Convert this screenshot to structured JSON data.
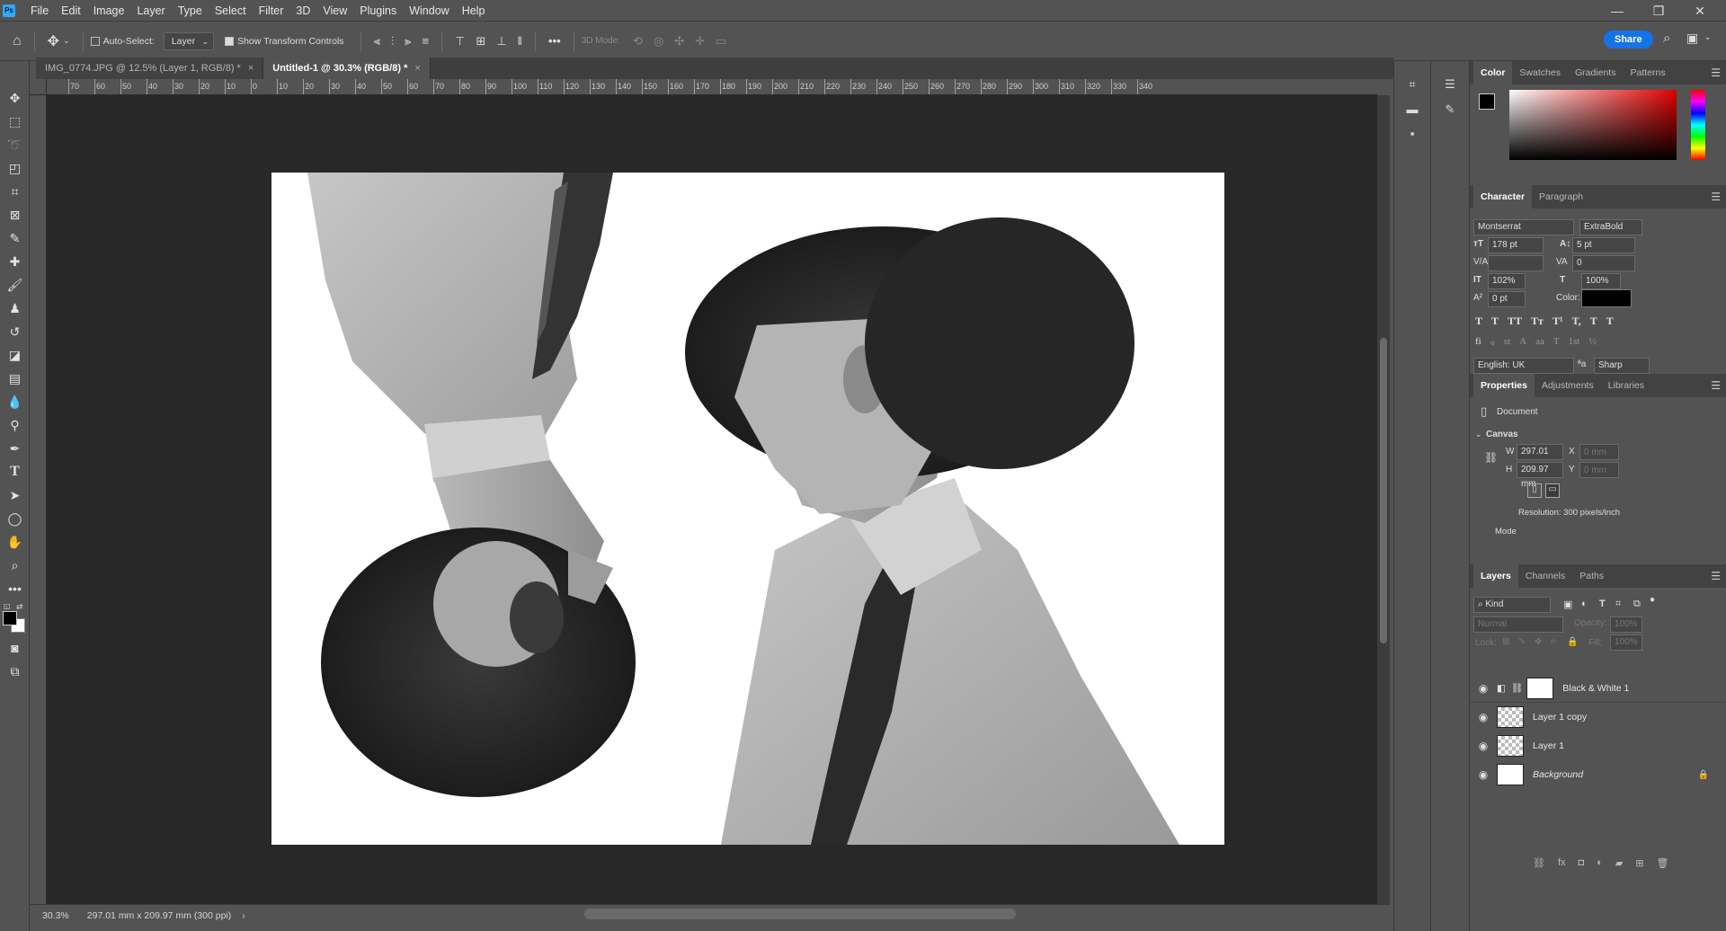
{
  "app": {
    "logo": "Ps"
  },
  "menu": [
    "File",
    "Edit",
    "Image",
    "Layer",
    "Type",
    "Select",
    "Filter",
    "3D",
    "View",
    "Plugins",
    "Window",
    "Help"
  ],
  "window_controls": {
    "minimize": "—",
    "restore": "❐",
    "close": "✕"
  },
  "options_bar": {
    "auto_select_label": "Auto-Select:",
    "layer_select": "Layer",
    "show_transform_label": "Show Transform Controls",
    "mode_3d_label": "3D Mode:",
    "share_label": "Share",
    "more": "•••"
  },
  "tabs": [
    {
      "label": "IMG_0774.JPG @ 12.5% (Layer 1, RGB/8) *",
      "active": false,
      "close": "×"
    },
    {
      "label": "Untitled-1 @ 30.3% (RGB/8) *",
      "active": true,
      "close": "×"
    }
  ],
  "ruler_labels": [
    "70",
    "60",
    "50",
    "40",
    "30",
    "20",
    "10",
    "0",
    "10",
    "20",
    "30",
    "40",
    "50",
    "60",
    "70",
    "80",
    "90",
    "100",
    "110",
    "120",
    "130",
    "140",
    "150",
    "160",
    "170",
    "180",
    "190",
    "200",
    "210",
    "220",
    "230",
    "240",
    "250",
    "260",
    "270",
    "280",
    "290",
    "300",
    "310",
    "320",
    "330",
    "340"
  ],
  "status": {
    "zoom": "30.3%",
    "doc_info": "297.01 mm x 209.97 mm (300 ppi)",
    "arrow": "›"
  },
  "color_panel": {
    "tabs": [
      "Color",
      "Swatches",
      "Gradients",
      "Patterns"
    ],
    "active": "Color"
  },
  "character_panel": {
    "tabs": [
      "Character",
      "Paragraph"
    ],
    "font_family": "Montserrat",
    "font_style": "ExtraBold",
    "font_size": "178 pt",
    "leading": "5 pt",
    "kerning": "",
    "tracking": "0",
    "vscale": "102%",
    "hscale": "100%",
    "baseline": "0 pt",
    "color_label": "Color:",
    "language": "English: UK",
    "antialias": "Sharp",
    "aa_glyph": "ªa",
    "type_styles": [
      "T",
      "T",
      "TT",
      "Tт",
      "T¹",
      "T,",
      "T",
      "T"
    ],
    "opentype": [
      "fi",
      "ℴ",
      "st",
      "A",
      "aa",
      "T",
      "1st",
      "½"
    ]
  },
  "properties_panel": {
    "tabs": [
      "Properties",
      "Adjustments",
      "Libraries"
    ],
    "doc_label": "Document",
    "canvas_label": "Canvas",
    "w_label": "W",
    "w_value": "297.01 mm",
    "h_label": "H",
    "h_value": "209.97 mm",
    "x_label": "X",
    "x_placeholder": "0 mm",
    "y_label": "Y",
    "y_placeholder": "0 mm",
    "resolution": "Resolution: 300 pixels/inch",
    "mode_label": "Mode"
  },
  "layers_panel": {
    "tabs": [
      "Layers",
      "Channels",
      "Paths"
    ],
    "kind_label": "Kind",
    "blend_mode": "Normal",
    "opacity_label": "Opacity:",
    "opacity_value": "100%",
    "lock_label": "Lock:",
    "fill_label": "Fill:",
    "fill_value": "100%",
    "layers": [
      {
        "name": "Black & White 1",
        "italic": false
      },
      {
        "name": "Layer 1 copy",
        "italic": false
      },
      {
        "name": "Layer 1",
        "italic": false
      },
      {
        "name": "Background",
        "italic": true
      }
    ],
    "footer_icons": [
      "link-icon",
      "fx-icon",
      "mask-icon",
      "adjustment-icon",
      "folder-icon",
      "new-layer-icon",
      "trash-icon"
    ]
  },
  "colors": {
    "accent": "#1473e6",
    "panel_bg": "#535353",
    "canvas_bg": "#282828"
  }
}
